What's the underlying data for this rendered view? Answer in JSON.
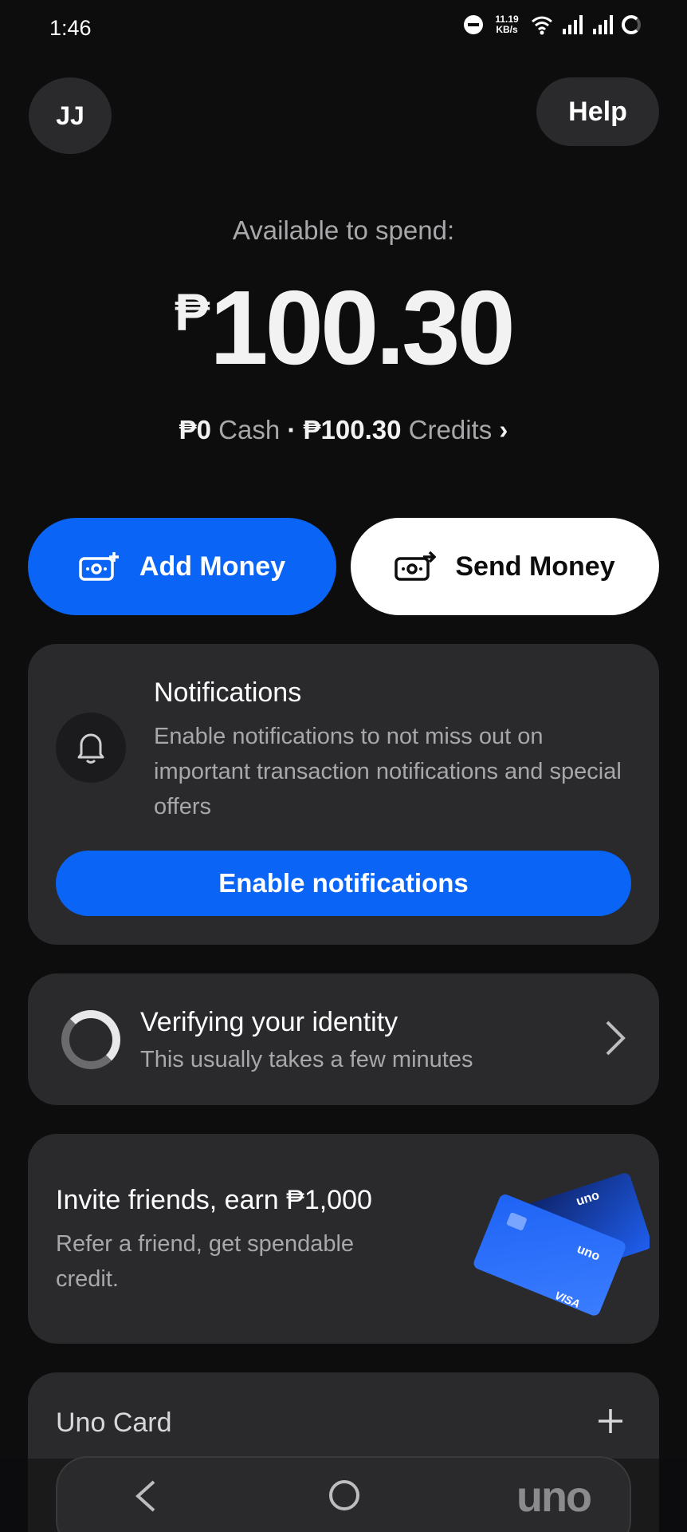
{
  "status_bar": {
    "time": "1:46",
    "net_speed_value": "11.19",
    "net_speed_unit": "KB/s"
  },
  "header": {
    "avatar_initials": "JJ",
    "help_label": "Help"
  },
  "balance": {
    "label": "Available to spend:",
    "currency_symbol": "₱",
    "amount": "100.30",
    "cash_amount": "₱0",
    "cash_label": "Cash",
    "separator": "·",
    "credits_amount": "₱100.30",
    "credits_label": "Credits",
    "credits_chevron": "›"
  },
  "actions": {
    "add_money_label": "Add Money",
    "send_money_label": "Send Money"
  },
  "notifications_card": {
    "title": "Notifications",
    "body": "Enable notifications to not miss out on important transaction notifications and special offers",
    "button_label": "Enable notifications"
  },
  "verify_card": {
    "title": "Verifying your identity",
    "subtitle": "This usually takes a few minutes"
  },
  "invite_card": {
    "title": "Invite friends, earn ₱1,000",
    "subtitle": "Refer a friend, get spendable credit.",
    "card_brand": "uno",
    "card_network": "VISA"
  },
  "uno_card": {
    "title": "Uno Card"
  },
  "nav": {
    "logo": "uno"
  },
  "colors": {
    "background": "#0d0d0e",
    "card": "#2a2a2c",
    "accent_blue": "#0a64f5",
    "muted_text": "#a8a8ab"
  },
  "icons": {
    "status": [
      "do-not-disturb-icon",
      "wifi-icon",
      "signal-icon",
      "signal-icon",
      "loading-icon"
    ],
    "add_money": "cash-plus-icon",
    "send_money": "cash-send-icon",
    "notifications": "bell-icon",
    "verify": "spinner-icon",
    "chevron": "chevron-right-icon",
    "uno_card_action": "plus-icon",
    "nav": [
      "back-icon",
      "home-icon"
    ]
  }
}
